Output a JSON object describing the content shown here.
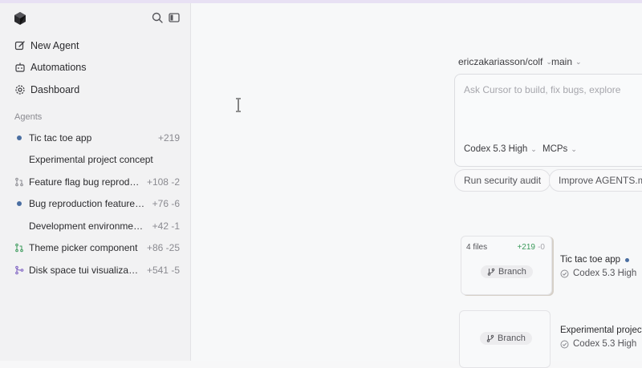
{
  "sidebar": {
    "nav": [
      {
        "label": "New Agent",
        "icon": "edit-icon"
      },
      {
        "label": "Automations",
        "icon": "robot-icon"
      },
      {
        "label": "Dashboard",
        "icon": "gear-icon"
      }
    ],
    "section_label": "Agents",
    "agents": [
      {
        "name": "Tic tac toe app",
        "diff": "+219",
        "lead": "dot"
      },
      {
        "name": "Experimental project concept",
        "diff": "",
        "lead": "none"
      },
      {
        "name": "Feature flag bug reproduc…",
        "diff": "+108 -2",
        "lead": "pr"
      },
      {
        "name": "Bug reproduction feature fl…",
        "diff": "+76 -6",
        "lead": "dot"
      },
      {
        "name": "Development environment …",
        "diff": "+42 -1",
        "lead": "none"
      },
      {
        "name": "Theme picker component",
        "diff": "+86 -25",
        "lead": "pr-green"
      },
      {
        "name": "Disk space tui visualization",
        "diff": "+541 -5",
        "lead": "merge"
      }
    ]
  },
  "main": {
    "repo": "ericzakariasson/colf",
    "branch": "main",
    "composer": {
      "placeholder": "Ask Cursor to build, fix bugs, explore",
      "model": "Codex 5.3 High",
      "mcps": "MCPs"
    },
    "suggestions": [
      "Run security audit",
      "Improve AGENTS.md"
    ],
    "tasks": [
      {
        "title": "Tic tac toe app",
        "model": "Codex 5.3 High",
        "files": "4 files",
        "plus": "+219",
        "minus": "-0",
        "branch_label": "Branch"
      },
      {
        "title": "Experimental project",
        "model": "Codex 5.3 High",
        "branch_label": "Branch"
      }
    ]
  },
  "colors": {
    "accent_dot": "#4a6ea1",
    "diff_add": "#3a9a5a",
    "sidebar_bg": "#f2f2f3",
    "main_bg": "#f7f8f9"
  }
}
